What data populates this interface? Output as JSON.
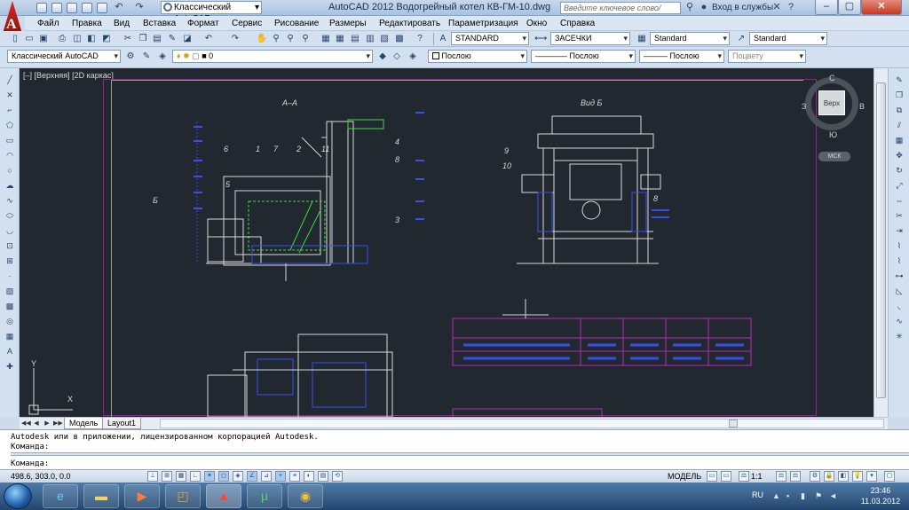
{
  "window": {
    "title": "AutoCAD 2012   Водогрейный котел КВ-ГМ-10.dwg",
    "workspace": "Классический AutoCAD",
    "search_placeholder": "Введите ключевое слово/фразу",
    "login": "Вход в службы"
  },
  "menu": [
    "Файл",
    "Правка",
    "Вид",
    "Вставка",
    "Формат",
    "Сервис",
    "Рисование",
    "Размеры",
    "Редактировать",
    "Параметризация",
    "Окно",
    "Справка"
  ],
  "styles": {
    "text_style": "STANDARD",
    "dim_style": "ЗАСЕЧКИ",
    "table_style": "Standard",
    "multileader_style": "Standard"
  },
  "layers": {
    "workspace": "Классический AutoCAD",
    "current_layer": "0",
    "color": "Послою",
    "linetype": "Послою",
    "lineweight": "Послою",
    "plot_style": "Поцвету"
  },
  "drawing": {
    "view_label": "[–] [Верхняя] [2D каркас]",
    "section_label": "А–А",
    "view_b_label": "Вид Б",
    "b_marker": "Б",
    "callouts": [
      "6",
      "1",
      "7",
      "2",
      "11",
      "4",
      "8",
      "5",
      "3",
      "9",
      "10",
      "8"
    ],
    "ucs_y": "Y",
    "ucs_x": "X"
  },
  "viewcube": {
    "top": "Верх",
    "north": "С",
    "south": "Ю",
    "west": "З",
    "east": "В",
    "wcs": "МСК"
  },
  "tabs": {
    "model": "Модель",
    "layout": "Layout1"
  },
  "command": {
    "line1": "Autodesk или в приложении, лицензированном корпорацией Autodesk.",
    "line2": "Команда:",
    "prompt": "Команда:"
  },
  "status": {
    "coordinates": "498.6, 303.0, 0.0",
    "space": "МОДЕЛЬ",
    "scale": "1:1"
  },
  "taskbar": {
    "lang": "RU",
    "time": "23:46",
    "date": "11.03.2012"
  }
}
